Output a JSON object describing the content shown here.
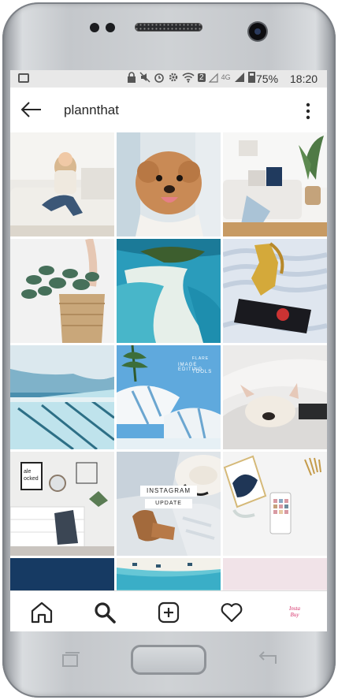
{
  "status_bar": {
    "battery_percent": "75%",
    "time": "18:20",
    "network_badge": "2",
    "network_type": "4G"
  },
  "app_bar": {
    "title": "plannthat",
    "back_icon": "arrow-left-icon",
    "more_icon": "more-vertical-icon"
  },
  "grid": {
    "tiles": [
      {
        "subject": "woman-on-sofa"
      },
      {
        "subject": "poodle-dog"
      },
      {
        "subject": "living-room"
      },
      {
        "subject": "eucalyptus-basket"
      },
      {
        "subject": "tropical-island"
      },
      {
        "subject": "gold-award"
      },
      {
        "subject": "ocean-pool"
      },
      {
        "subject": "beach-umbrellas",
        "text_lines": [
          "FLARE",
          "IMAGE EDITING",
          "TOOLS"
        ]
      },
      {
        "subject": "sleeping-bulldog"
      },
      {
        "subject": "home-office",
        "poster_text": "ale ocked"
      },
      {
        "subject": "flatlay-hat",
        "banner_top": "INSTAGRAM",
        "banner_bottom": "UPDATE"
      },
      {
        "subject": "desk-phone"
      },
      {
        "subject": "navy-block"
      },
      {
        "subject": "beach-aerial"
      },
      {
        "subject": "pink-blank"
      }
    ]
  },
  "bottom_nav": {
    "items": [
      "home-icon",
      "search-icon",
      "add-post-icon",
      "activity-heart-icon",
      "profile-avatar"
    ],
    "avatar_text": "Insta Buy"
  },
  "hardware": {
    "buttons": [
      "recent-apps-button",
      "home-button",
      "back-button"
    ]
  }
}
